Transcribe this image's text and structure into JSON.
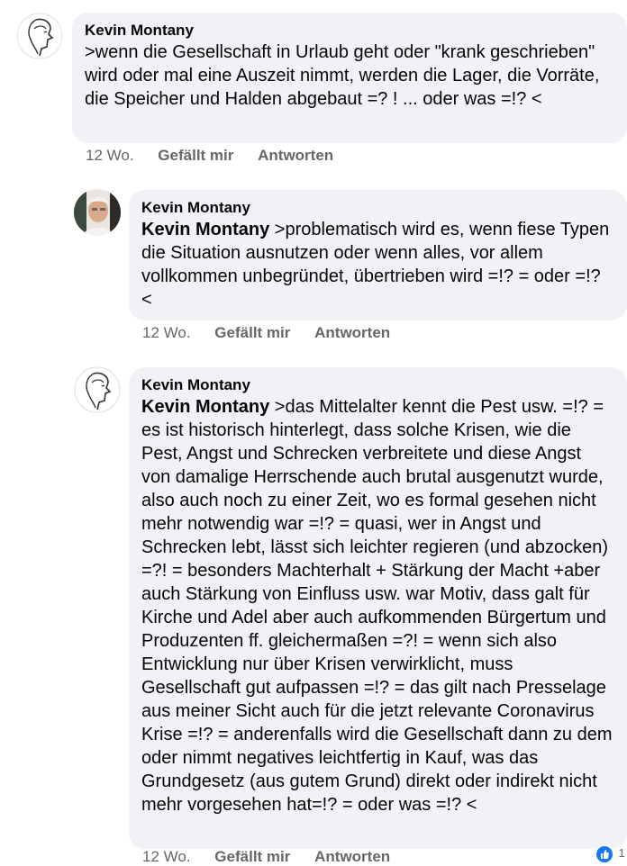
{
  "comments": [
    {
      "author": "Kevin Montany",
      "mention": "",
      "text": ">wenn die Gesellschaft in Urlaub geht oder \"krank geschrieben\" wird oder mal eine Auszeit nimmt, werden die  Lager, die Vorräte, die Speicher und Halden abgebaut =? ! ... oder was =!? <",
      "time": "12 Wo.",
      "like": "Gefällt mir",
      "reply": "Antworten",
      "avatar_icon": "sketch-face-avatar"
    },
    {
      "author": "Kevin Montany",
      "mention": "Kevin Montany",
      "text": " >problematisch wird es, wenn fiese Typen die Situation ausnutzen oder wenn alles, vor allem vollkommen unbegründet, übertrieben wird =!? = oder =!? <",
      "time": "12 Wo.",
      "like": "Gefällt mir",
      "reply": "Antworten",
      "avatar_icon": "photo-avatar"
    },
    {
      "author": "Kevin Montany",
      "mention": "Kevin Montany",
      "text": " >das Mittelalter kennt die Pest usw. =!? = es ist historisch hinterlegt, dass solche Krisen, wie die Pest, Angst und Schrecken verbreitete und diese Angst von  damalige Herrschende auch brutal ausgenutzt wurde, also auch noch zu einer Zeit, wo es formal gesehen nicht mehr notwendig war =!? = quasi, wer in Angst und Schrecken lebt, lässt sich leichter regieren (und abzocken) =?! = besonders Machterhalt + Stärkung der Macht +aber auch Stärkung von Einfluss usw. war Motiv, dass galt für Kirche und Adel aber auch aufkommenden Bürgertum und Produzenten ff. gleichermaßen =?! = wenn sich also Entwicklung  nur über Krisen verwirklicht, muss Gesellschaft gut aufpassen =!? = das gilt nach Presselage aus meiner Sicht auch für die jetzt relevante Coronavirus Krise =!? = anderenfalls wird die Gesellschaft dann zu dem oder nimmt negatives leichtfertig in Kauf, was das Grundgesetz (aus gutem Grund) direkt oder indirekt nicht mehr vorgesehen hat=!? = oder was =!? <",
      "time": "12 Wo.",
      "like": "Gefällt mir",
      "reply": "Antworten",
      "avatar_icon": "sketch-face-avatar",
      "reaction_icon": "like-reaction-icon",
      "reaction_count": "1"
    }
  ],
  "colors": {
    "bubble": "#f0f2f5",
    "meta": "#65676b",
    "like_blue": "#1877f2"
  }
}
